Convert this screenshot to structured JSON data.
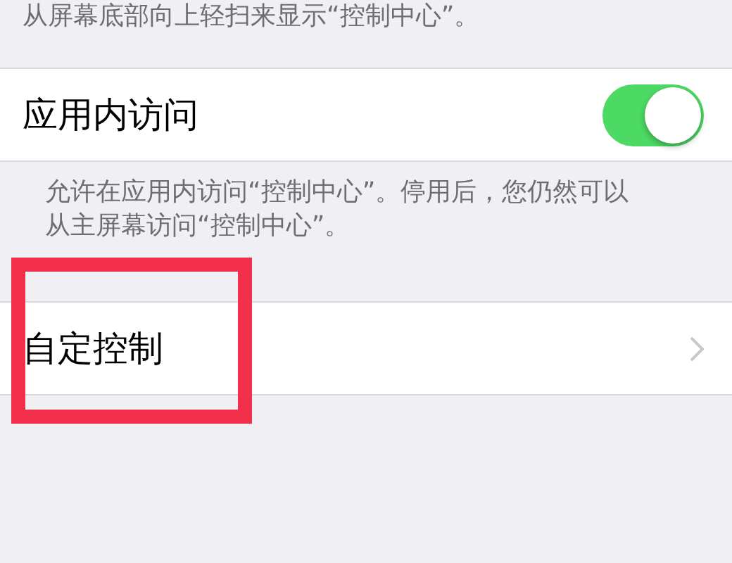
{
  "header_note": "从屏幕底部向上轻扫来显示“控制中心”。",
  "rows": [
    {
      "kind": "toggle",
      "label": "应用内访问",
      "on": true,
      "highlighted": false,
      "footer": "允许在应用内访问“控制中心”。停用后，您仍然可以从主屏幕访问“控制中心”。"
    },
    {
      "kind": "link",
      "label": "自定控制",
      "highlighted": true
    }
  ]
}
